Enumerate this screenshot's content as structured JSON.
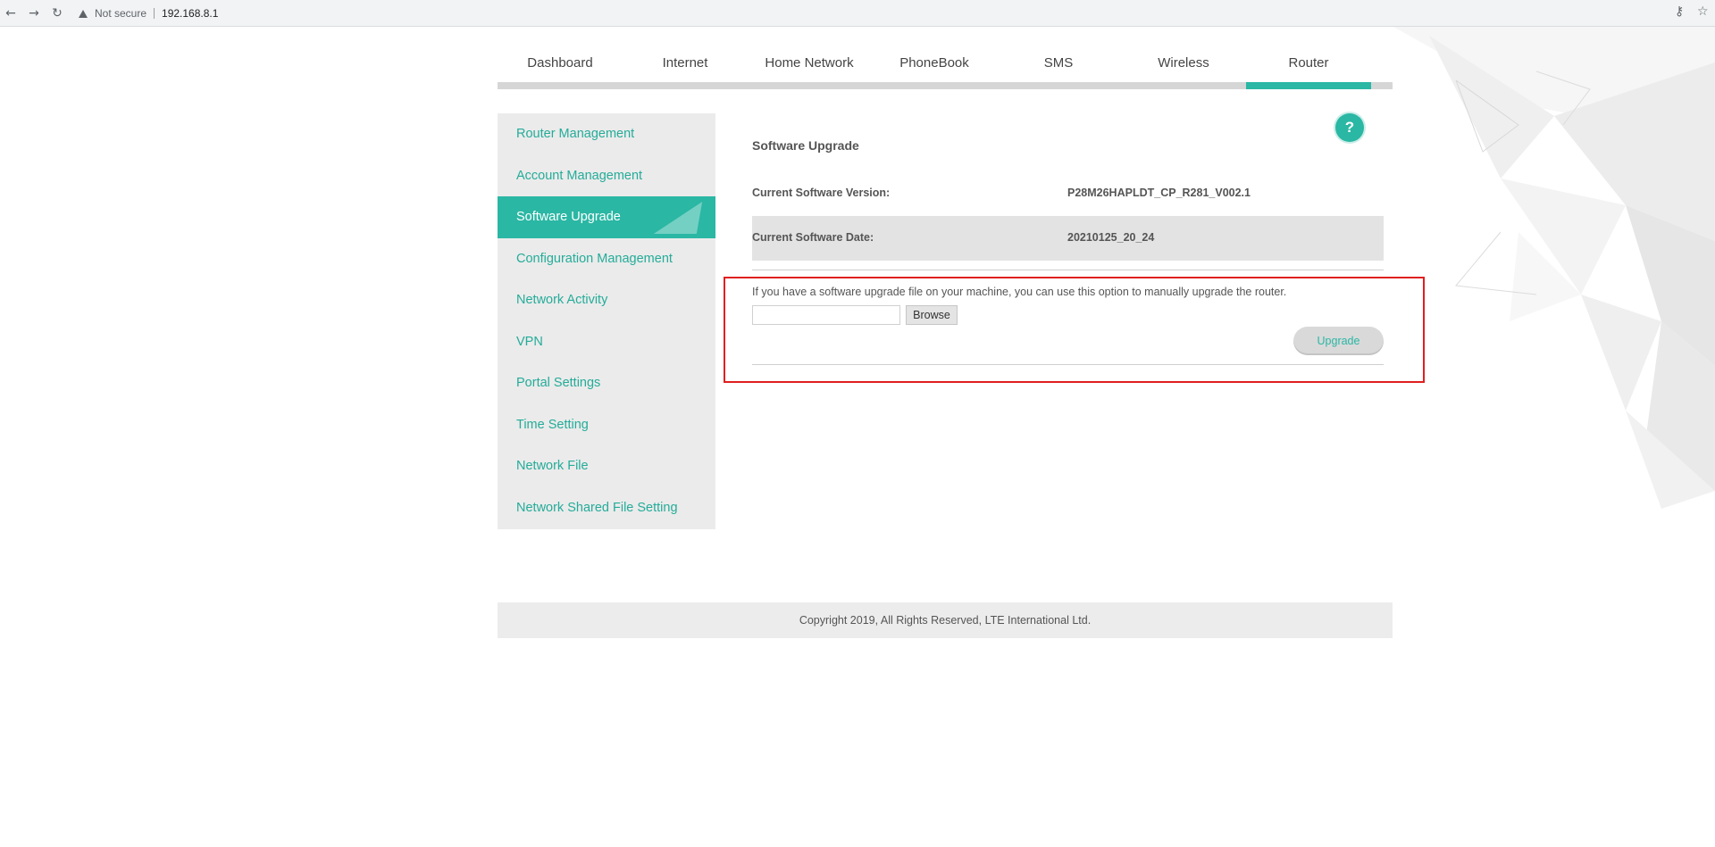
{
  "browser": {
    "back_icon": "←",
    "forward_icon": "→",
    "reload_icon": "↻",
    "security_label": "Not secure",
    "url": "192.168.8.1",
    "key_icon": "⚷",
    "star_icon": "☆"
  },
  "topnav": {
    "tabs": [
      {
        "label": "Dashboard"
      },
      {
        "label": "Internet"
      },
      {
        "label": "Home Network"
      },
      {
        "label": "PhoneBook"
      },
      {
        "label": "SMS"
      },
      {
        "label": "Wireless"
      },
      {
        "label": "Router"
      }
    ],
    "active_tab": "Router"
  },
  "sidebar": {
    "items": [
      {
        "label": "Router Management"
      },
      {
        "label": "Account Management"
      },
      {
        "label": "Software Upgrade"
      },
      {
        "label": "Configuration Management"
      },
      {
        "label": "Network Activity"
      },
      {
        "label": "VPN"
      },
      {
        "label": "Portal Settings"
      },
      {
        "label": "Time Setting"
      },
      {
        "label": "Network File"
      },
      {
        "label": "Network Shared File Setting"
      }
    ],
    "active_item": "Software Upgrade"
  },
  "content": {
    "title": "Software Upgrade",
    "help_label": "?",
    "version_label": "Current Software Version:",
    "version_value": "P28M26HAPLDT_CP_R281_V002.1",
    "date_label": "Current Software Date:",
    "date_value": "20210125_20_24",
    "upgrade_note": "If you have a software upgrade file on your machine, you can use this option to manually upgrade the router.",
    "file_input_value": "",
    "browse_label": "Browse",
    "upgrade_label": "Upgrade"
  },
  "footer": {
    "copyright": "Copyright 2019, All Rights Reserved, LTE International Ltd."
  },
  "colors": {
    "accent": "#2ab7a4",
    "highlight": "#e01f1f"
  }
}
